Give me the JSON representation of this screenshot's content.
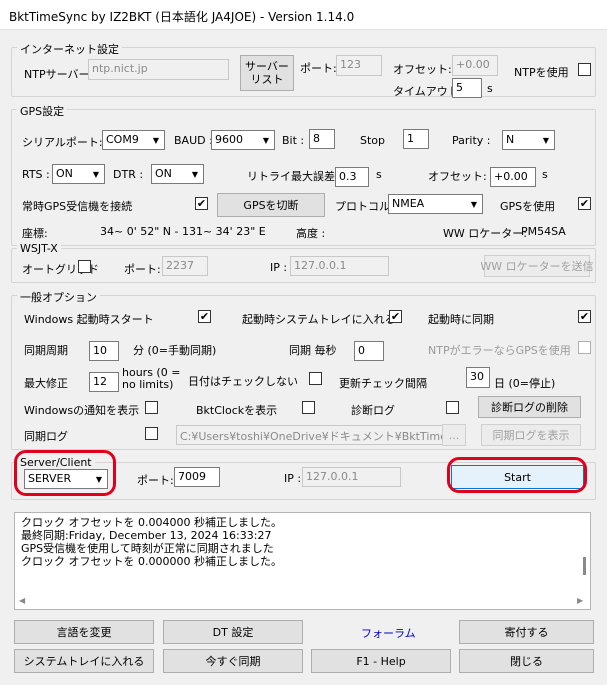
{
  "window": {
    "title": "BktTimeSync by IZ2BKT (日本語化 JA4JOE) - Version 1.14.0"
  },
  "internet": {
    "group_title": "インターネット設定",
    "ntp_server_label": "NTPサーバー",
    "ntp_server_value": "ntp.nict.jp",
    "server_list_button": "サーバー\nリスト",
    "port_label": "ポート:",
    "port_value": "123",
    "offset_label": "オフセット:",
    "offset_value": "+0.00",
    "timeout_label": "タイムアウト:",
    "timeout_value": "5",
    "timeout_unit": "s",
    "use_ntp_label": "NTPを使用",
    "use_ntp_checked": false
  },
  "gps": {
    "group_title": "GPS設定",
    "serial_port_label": "シリアルポート:",
    "serial_port_value": "COM9",
    "baud_label": "BAUD :",
    "baud_value": "9600",
    "bit_label": "Bit :",
    "bit_value": "8",
    "stop_label": "Stop",
    "stop_value": "1",
    "parity_label": "Parity :",
    "parity_value": "N",
    "rts_label": "RTS :",
    "rts_value": "ON",
    "dtr_label": "DTR :",
    "dtr_value": "ON",
    "retry_label": "リトライ最大誤差:",
    "retry_value": "0.3",
    "retry_unit": "s",
    "offset_label": "オフセット:",
    "offset_value": "+0.00",
    "offset_unit": "s",
    "always_connect_label": "常時GPS受信機を接続",
    "always_connect_checked": true,
    "disconnect_button": "GPSを切断",
    "protocol_label": "プロトコル:",
    "protocol_value": "NMEA",
    "use_gps_label": "GPSを使用",
    "use_gps_checked": true,
    "coords_label": "座標:",
    "coords_value": "34~ 0' 52\" N - 131~ 34' 23\" E",
    "altitude_label": "高度 :",
    "locator_label": "WW ロケーター:",
    "locator_value": "PM54SA"
  },
  "wsjtx": {
    "group_title": "WSJT-X",
    "autogrid_label": "オートグリッド",
    "autogrid_checked": false,
    "port_label": "ポート:",
    "port_value": "2237",
    "ip_label": "IP :",
    "ip_value": "127.0.0.1",
    "send_locator_button": "WW ロケーターを送信"
  },
  "general": {
    "group_title": "一般オプション",
    "windows_startup_label": "Windows 起動時スタート",
    "windows_startup_checked": true,
    "tray_on_start_label": "起動時システムトレイに入れる",
    "tray_on_start_checked": true,
    "sync_on_start_label": "起動時に同期",
    "sync_on_start_checked": true,
    "sync_period_label": "同期周期",
    "sync_period_value": "10",
    "sync_period_unit": "分 (0=手動同期)",
    "sync_every_sec_label": "同期 毎秒",
    "sync_every_sec_value": "0",
    "ntp_fallback_label": "NTPがエラーならGPSを使用",
    "ntp_fallback_checked": false,
    "max_correction_label": "最大修正",
    "max_correction_value": "12",
    "max_correction_unit": "hours (0 =\nno limits)",
    "no_date_check_label": "日付はチェックしない",
    "no_date_check_checked": false,
    "update_interval_label": "更新チェック間隔",
    "update_interval_value": "30",
    "update_interval_unit": "日 (0=停止)",
    "show_notify_label": "Windowsの通知を表示",
    "show_notify_checked": false,
    "show_bktclock_label": "BktClockを表示",
    "show_bktclock_checked": false,
    "diag_log_label": "診断ログ",
    "diag_log_checked": false,
    "delete_diag_button": "診断ログの削除",
    "sync_log_label": "同期ログ",
    "sync_log_checked": false,
    "log_path_value": "C:¥Users¥toshi¥OneDrive¥ドキュメント¥BktTimeSyncL",
    "browse_button": "...",
    "show_sync_log_button": "同期ログを表示"
  },
  "server_client": {
    "group_title": "Server/Client",
    "mode_value": "SERVER",
    "port_label": "ポート:",
    "port_value": "7009",
    "ip_label": "IP :",
    "ip_value": "127.0.0.1",
    "start_button": "Start",
    "highlight_color": "#e0001b"
  },
  "log": {
    "lines": [
      "クロック オフセットを 0.004000 秒補正しました。",
      "最終同期:Friday, December 13, 2024 16:33:27",
      "GPS受信機を使用して時刻が正常に同期されました",
      "クロック オフセットを 0.000000 秒補正しました。"
    ]
  },
  "footer": {
    "change_language_button": "言語を変更",
    "dt_settings_button": "DT 設定",
    "forum_link": "フォーラム",
    "forum_color": "#0000cc",
    "donate_button": "寄付する",
    "to_tray_button": "システムトレイに入れる",
    "sync_now_button": "今すぐ同期",
    "help_button": "F1 - Help",
    "close_button": "閉じる"
  }
}
